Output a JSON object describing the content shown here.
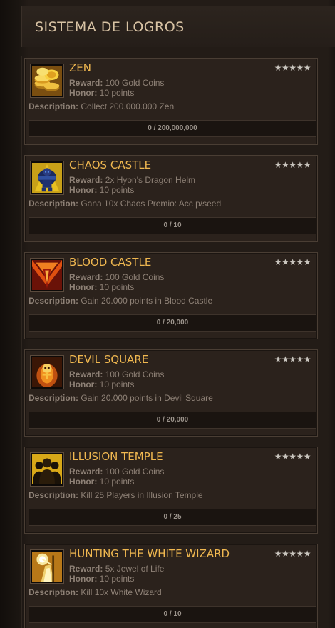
{
  "header": {
    "title": "SISTEMA DE LOGROS"
  },
  "labels": {
    "reward": "Reward:",
    "honor": "Honor:",
    "description": "Description:"
  },
  "achievements": [
    {
      "title": "ZEN",
      "stars": "★★★★★",
      "reward": "100 Gold Coins",
      "honor": "10 points",
      "description": "Collect 200.000.000 Zen",
      "progress_text": "0 / 200,000,000",
      "progress": 0,
      "icon": "gold-coins-icon"
    },
    {
      "title": "CHAOS CASTLE",
      "stars": "★★★★★",
      "reward": "2x Hyon's Dragon Helm",
      "honor": "10 points",
      "description": "Gana 10x Chaos Premio: Acc p/seed",
      "progress_text": "0 / 10",
      "progress": 0,
      "icon": "armored-knight-icon"
    },
    {
      "title": "BLOOD CASTLE",
      "stars": "★★★★★",
      "reward": "100 Gold Coins",
      "honor": "10 points",
      "description": "Gain 20.000 points in Blood Castle",
      "progress_text": "0 / 20,000",
      "progress": 0,
      "icon": "blood-castle-icon"
    },
    {
      "title": "DEVIL SQUARE",
      "stars": "★★★★★",
      "reward": "100 Gold Coins",
      "honor": "10 points",
      "description": "Gain 20.000 points in Devil Square",
      "progress_text": "0 / 20,000",
      "progress": 0,
      "icon": "skull-flame-icon"
    },
    {
      "title": "ILLUSION TEMPLE",
      "stars": "★★★★★",
      "reward": "100 Gold Coins",
      "honor": "10 points",
      "description": "Kill 25 Players in Illusion Temple",
      "progress_text": "0 / 25",
      "progress": 0,
      "icon": "players-silhouette-icon"
    },
    {
      "title": "HUNTING THE WHITE WIZARD",
      "stars": "★★★★★",
      "reward": "5x Jewel of Life",
      "honor": "10 points",
      "description": "Kill 10x White Wizard",
      "progress_text": "0 / 10",
      "progress": 0,
      "icon": "white-wizard-icon"
    }
  ]
}
